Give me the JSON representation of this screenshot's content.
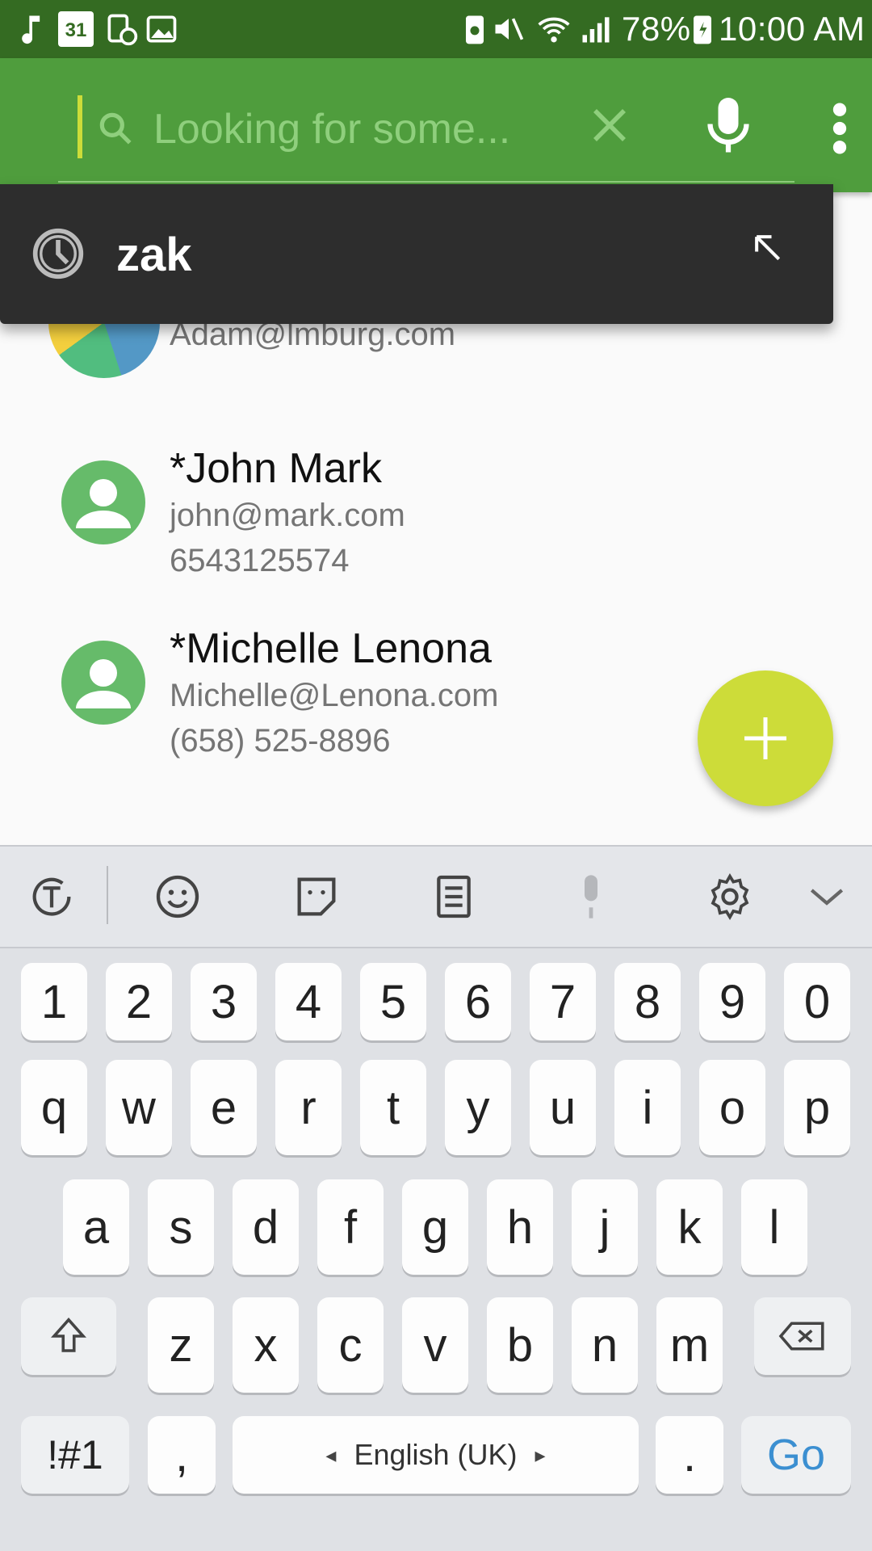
{
  "status_bar": {
    "battery": "78%",
    "time": "10:00 AM",
    "left_icons": [
      "music-icon",
      "calendar-icon",
      "screen-record-icon",
      "image-icon"
    ],
    "calendar_day": "31",
    "right_icons": [
      "battery-saver-icon",
      "mute-icon",
      "wifi-icon",
      "signal-icon",
      "battery-icon"
    ]
  },
  "search": {
    "placeholder": "Looking for some...",
    "value": ""
  },
  "suggestion": {
    "text": "zak"
  },
  "contacts": [
    {
      "email": "Adam@lmburg.com"
    },
    {
      "name": "*John Mark",
      "email": "john@mark.com",
      "phone": "6543125574"
    },
    {
      "name": "*Michelle Lenona",
      "email": "Michelle@Lenona.com",
      "phone": "(658) 525-8896"
    }
  ],
  "fab": {
    "icon": "plus-icon"
  },
  "keyboard": {
    "toolbar": [
      "text-mode-icon",
      "emoji-icon",
      "sticker-icon",
      "clipboard-icon",
      "mic-icon",
      "settings-icon",
      "chevron-down-icon"
    ],
    "number_row": [
      "1",
      "2",
      "3",
      "4",
      "5",
      "6",
      "7",
      "8",
      "9",
      "0"
    ],
    "row1": [
      "q",
      "w",
      "e",
      "r",
      "t",
      "y",
      "u",
      "i",
      "o",
      "p"
    ],
    "row2": [
      "a",
      "s",
      "d",
      "f",
      "g",
      "h",
      "j",
      "k",
      "l"
    ],
    "row3": [
      "z",
      "x",
      "c",
      "v",
      "b",
      "n",
      "m"
    ],
    "symbols_label": "!#1",
    "comma_label": ",",
    "space_label": "English (UK)",
    "period_label": ".",
    "go_label": "Go"
  },
  "colors": {
    "status_bar": "#346b22",
    "app_bar": "#4f9d3d",
    "accent": "#cddc39",
    "avatar": "#66bb6a",
    "suggestion_bg": "#2d2d2d"
  }
}
